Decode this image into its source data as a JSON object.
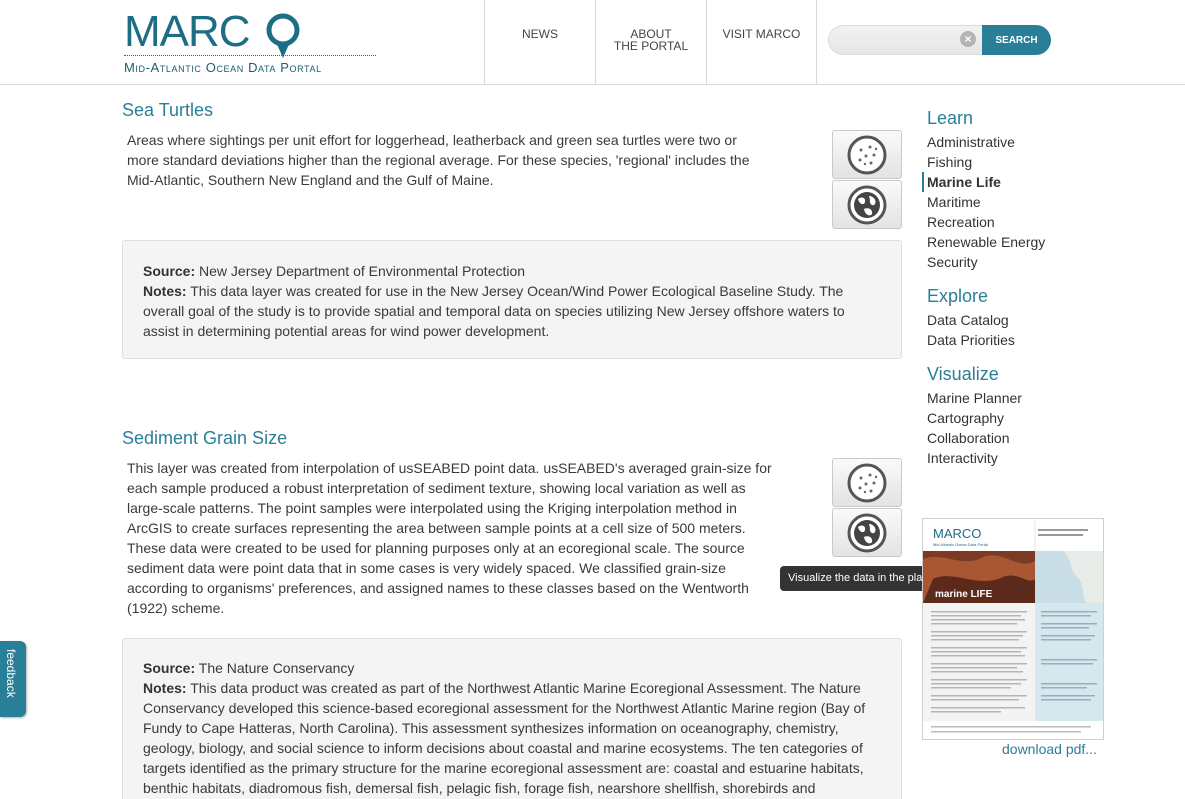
{
  "header": {
    "logo_text": "MARCO",
    "logo_subtitle": "Mid-Atlantic Ocean Data Portal",
    "nav": [
      {
        "label": "NEWS",
        "label2": ""
      },
      {
        "label": "ABOUT",
        "label2": "THE PORTAL"
      },
      {
        "label": "VISIT MARCO",
        "label2": ""
      }
    ],
    "search": {
      "value": "",
      "placeholder": "",
      "clear": "×",
      "button": "SEARCH"
    }
  },
  "layers": [
    {
      "title": "Sea Turtles",
      "description": "Areas where sightings per unit effort for loggerhead, leatherback and green sea turtles were two or more standard deviations higher than the regional average. For these species, 'regional' includes the Mid-Atlantic, Southern New England and the Gulf of Maine.",
      "source_label": "Source:",
      "source": "New Jersey Department of Environmental Protection",
      "notes_label": "Notes:",
      "notes": "This data layer was created for use in the New Jersey Ocean/Wind Power Ecological Baseline Study. The overall goal of the study is to provide spatial and temporal data on species utilizing New Jersey offshore waters to assist in determining potential areas for wind power development."
    },
    {
      "title": "Sediment Grain Size",
      "description": "This layer was created from interpolation of usSEABED point data. usSEABED's averaged grain-size for each sample produced a robust interpretation of sediment texture, showing local variation as well as large-scale patterns. The point samples were interpolated using the Kriging interpolation method in ArcGIS to create surfaces representing the area between sample points at a cell size of 500 meters. These data were created to be used for planning purposes only at an ecoregional scale. The source sediment data were point data that in some cases is very widely spaced. We classified grain-size according to organisms' preferences, and assigned names to these classes based on the Wentworth (1922) scheme.",
      "source_label": "Source:",
      "source": "The Nature Conservancy",
      "notes_label": "Notes:",
      "notes": "This data product was created as part of the Northwest Atlantic Marine Ecoregional Assessment. The Nature Conservancy developed this science-based ecoregional assessment for the Northwest Atlantic Marine region (Bay of Fundy to Cape Hatteras, North Carolina). This assessment synthesizes information on oceanography, chemistry, geology, biology, and social science to inform decisions about coastal and marine ecosystems. The ten categories of targets identified as the primary structure for the marine ecoregional assessment are: coastal and estuarine habitats, benthic habitats, diadromous fish, demersal fish, pelagic fish, forage fish, nearshore shellfish, shorebirds and"
    }
  ],
  "tooltip": "Visualize the data in the planner.",
  "sidebar": {
    "learn": {
      "title": "Learn",
      "items": [
        "Administrative",
        "Fishing",
        "Marine Life",
        "Maritime",
        "Recreation",
        "Renewable Energy",
        "Security"
      ],
      "active": "Marine Life"
    },
    "explore": {
      "title": "Explore",
      "items": [
        "Data Catalog",
        "Data Priorities"
      ]
    },
    "visualize": {
      "title": "Visualize",
      "items": [
        "Marine Planner",
        "Cartography",
        "Collaboration",
        "Interactivity"
      ]
    },
    "brochure": {
      "logo": "MARCO",
      "subtitle": "Mid-Atlantic Ocean Data Portal",
      "banner": "marine LIFE"
    },
    "download": "download pdf..."
  },
  "feedback": "feedback",
  "colors": {
    "accent": "#2a7f98",
    "logo": "#1d6d84",
    "tooltip_bg": "#333333",
    "box_bg": "#f4f4f4"
  }
}
